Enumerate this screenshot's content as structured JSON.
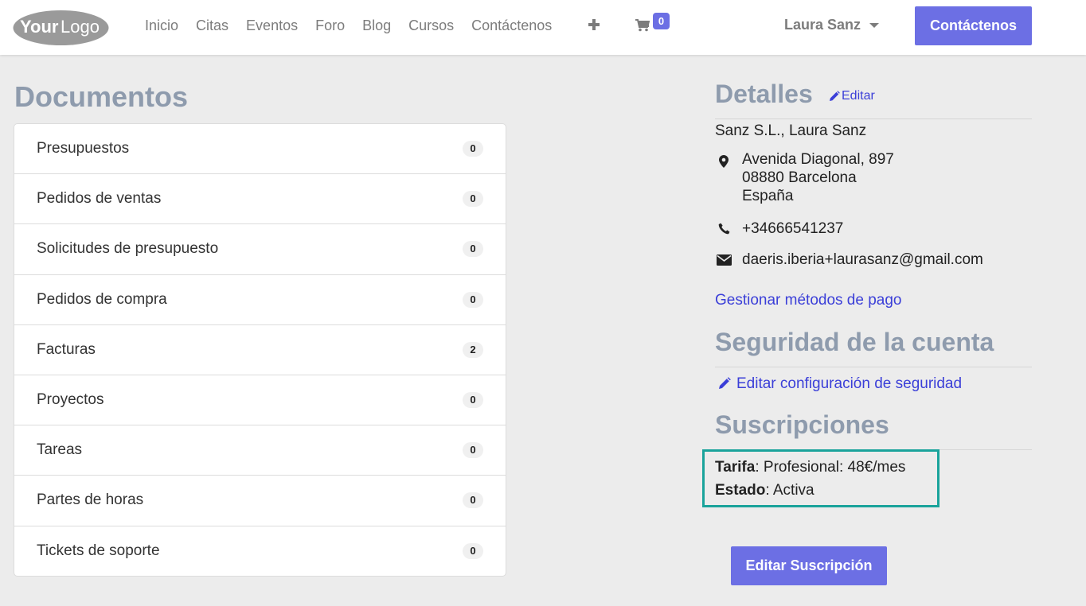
{
  "navbar": {
    "logo_text": "YourLogo",
    "links": [
      "Inicio",
      "Citas",
      "Eventos",
      "Foro",
      "Blog",
      "Cursos",
      "Contáctenos"
    ],
    "cart_count": "0",
    "user_name": "Laura Sanz",
    "contact_button": "Contáctenos"
  },
  "documents": {
    "title": "Documentos",
    "items": [
      {
        "label": "Presupuestos",
        "count": "0"
      },
      {
        "label": "Pedidos de ventas",
        "count": "0"
      },
      {
        "label": "Solicitudes de presupuesto",
        "count": "0"
      },
      {
        "label": "Pedidos de compra",
        "count": "0"
      },
      {
        "label": "Facturas",
        "count": "2"
      },
      {
        "label": "Proyectos",
        "count": "0"
      },
      {
        "label": "Tareas",
        "count": "0"
      },
      {
        "label": "Partes de horas",
        "count": "0"
      },
      {
        "label": "Tickets de soporte",
        "count": "0"
      }
    ]
  },
  "details": {
    "title": "Detalles",
    "edit_label": "Editar",
    "company_name": "Sanz S.L., Laura Sanz",
    "address": {
      "line1": "Avenida Diagonal, 897",
      "line2": "08880 Barcelona",
      "line3": "España"
    },
    "phone": "+34666541237",
    "email": "daeris.iberia+laurasanz@gmail.com",
    "payment_link": "Gestionar métodos de pago"
  },
  "security": {
    "title": "Seguridad de la cuenta",
    "edit_link": "Editar configuración de seguridad"
  },
  "subscriptions": {
    "title": "Suscripciones",
    "tarifa_label": "Tarifa",
    "tarifa_value": ": Profesional: 48€/mes",
    "estado_label": "Estado",
    "estado_value": ": Activa",
    "edit_button": "Editar Suscripción"
  },
  "colors": {
    "primary": "#6c6fe4",
    "heading": "#8e9bad",
    "link": "#3b3fd8",
    "highlight_border": "#1aa39b"
  }
}
